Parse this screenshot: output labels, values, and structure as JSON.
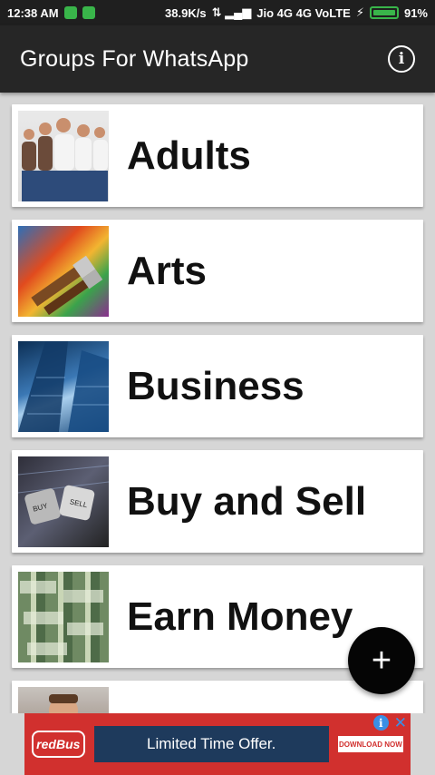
{
  "status_bar": {
    "time": "12:38 AM",
    "network_speed": "38.9K/s",
    "carrier": "Jio 4G 4G VoLTE",
    "battery": "91%"
  },
  "app_bar": {
    "title": "Groups For WhatsApp",
    "info_icon": "info-icon"
  },
  "categories": [
    {
      "label": "Adults",
      "thumbnail": "people-photo"
    },
    {
      "label": "Arts",
      "thumbnail": "paint-brushes-photo"
    },
    {
      "label": "Business",
      "thumbnail": "skyscrapers-photo"
    },
    {
      "label": "Buy and Sell",
      "thumbnail": "dice-buy-sell-photo"
    },
    {
      "label": "Earn Money",
      "thumbnail": "cash-stacks-photo"
    },
    {
      "label": "",
      "thumbnail": "man-photo"
    }
  ],
  "fab": {
    "label": "+",
    "icon": "add-icon"
  },
  "ad": {
    "brand": "redBus",
    "offer_text": "Limited Time Offer.",
    "cta": "DOWNLOAD NOW",
    "colors": {
      "background": "#d1302e",
      "offer_box": "#1e3a5c"
    }
  }
}
